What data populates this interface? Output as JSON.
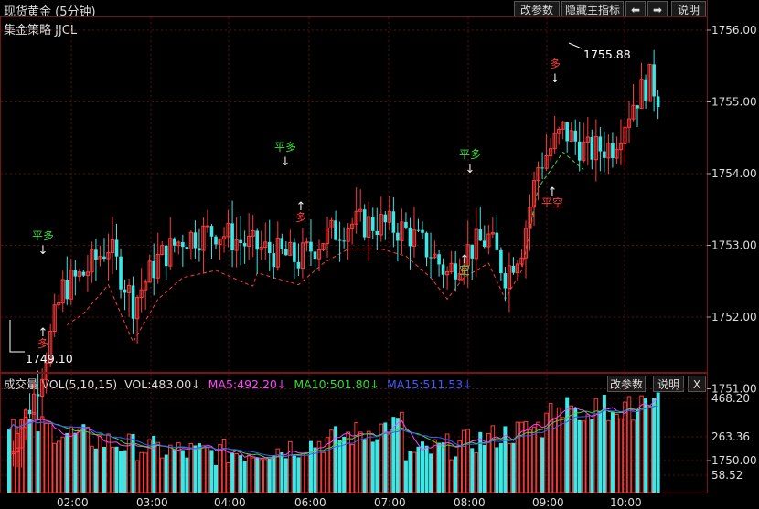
{
  "header": {
    "title": "现货黄金 (5分钟)",
    "subtitle": "集金策略 JJCL",
    "buttons": {
      "params": "改参数",
      "hide_indicator": "隐藏主指标",
      "prev": "⬅",
      "next": "➡",
      "help": "说明"
    }
  },
  "price_axis": {
    "labels": [
      "1756.00",
      "1755.00",
      "1754.00",
      "1753.00",
      "1752.00",
      "1751.00",
      "1750.00"
    ]
  },
  "annotations": {
    "high_label": "1755.88",
    "low_label": "1749.10",
    "signals": [
      {
        "text": "平多",
        "color": "#3ddc3d"
      },
      {
        "text": "多",
        "color": "#ff3b3b"
      },
      {
        "text": "平多",
        "color": "#3ddc3d"
      },
      {
        "text": "多",
        "color": "#ff3b3b"
      },
      {
        "text": "平多",
        "color": "#3ddc3d"
      },
      {
        "text": "空",
        "color": "#3ddc3d"
      },
      {
        "text": "多",
        "color": "#ff3b3b"
      },
      {
        "text": "平空",
        "color": "#ff3b3b"
      }
    ]
  },
  "volume_panel": {
    "label": "成交量 VOL(5,10,15)",
    "vol": "VOL:483.00↓",
    "ma5": "MA5:492.20↓",
    "ma10": "MA10:501.80↓",
    "ma15": "MA15:511.53↓",
    "buttons": {
      "params": "改参数",
      "help": "说明",
      "close": "X"
    },
    "axis_labels": [
      "468.20",
      "263.36",
      "58.52"
    ],
    "colors": {
      "ma5": "#ff44ff",
      "ma10": "#33dd33",
      "ma15": "#3b5bff",
      "vol": "#dddddd"
    }
  },
  "time_axis": {
    "labels": [
      "02:00",
      "03:00",
      "04:00",
      "06:00",
      "07:00",
      "08:00",
      "09:00",
      "10:00"
    ]
  },
  "colors": {
    "up": "#ff3b3b",
    "down": "#3ee6e6",
    "grid": "#5a0f0f"
  }
}
